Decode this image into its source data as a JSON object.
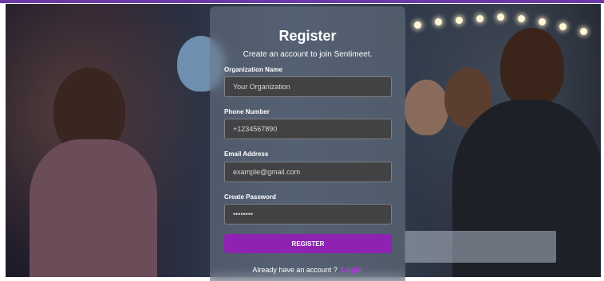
{
  "colors": {
    "accent": "#8f22b3",
    "link": "#b43be0",
    "field_bg": "#424245",
    "card_bg": "rgba(110,120,135,0.55)"
  },
  "form": {
    "title": "Register",
    "subtitle": "Create an account to join Sentimeet.",
    "fields": [
      {
        "label": "Organization Name",
        "value": "Your Organization"
      },
      {
        "label": "Phone Number",
        "value": "+1234567890"
      },
      {
        "label": "Email Address",
        "value": "example@gmail.com"
      },
      {
        "label": "Create Password",
        "value": "••••••••"
      }
    ],
    "submit_label": "REGISTER",
    "footer_text": "Already have an account ?",
    "login_link": "Login"
  }
}
